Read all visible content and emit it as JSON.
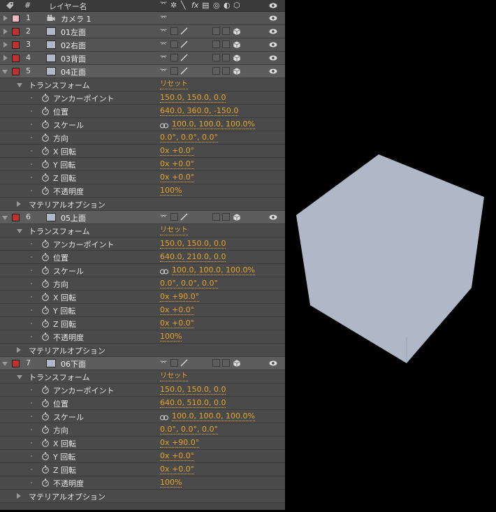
{
  "header": {
    "name_col": "レイヤー名",
    "num_col": "#",
    "fx": "fx"
  },
  "colors": {
    "panel": "#464646",
    "value": "#e8a52a",
    "cube": "#b0b7c6",
    "label_red": "#c0312f",
    "label_pink": "#f0b8c0"
  },
  "layers": [
    {
      "num": "1",
      "name": "カメラ 1",
      "label_color": "#f0b8c0",
      "type": "camera",
      "expanded": false
    },
    {
      "num": "2",
      "name": "01左面",
      "label_color": "#c0312f",
      "type": "solid",
      "expanded": false
    },
    {
      "num": "3",
      "name": "02右面",
      "label_color": "#c0312f",
      "type": "solid",
      "expanded": false
    },
    {
      "num": "4",
      "name": "03背面",
      "label_color": "#c0312f",
      "type": "solid",
      "expanded": false
    },
    {
      "num": "5",
      "name": "04正面",
      "label_color": "#c0312f",
      "type": "solid",
      "expanded": true,
      "transform": {
        "anchor": "150.0, 150.0, 0.0",
        "position": "640.0, 360.0, -150.0",
        "scale": "100.0, 100.0, 100.0%",
        "orientation": "0.0°, 0.0°, 0.0°",
        "x_rot": "0x +0.0°",
        "y_rot": "0x +0.0°",
        "z_rot": "0x +0.0°",
        "opacity": "100%"
      }
    },
    {
      "num": "6",
      "name": "05上面",
      "label_color": "#c0312f",
      "type": "solid",
      "expanded": true,
      "transform": {
        "anchor": "150.0, 150.0, 0.0",
        "position": "640.0, 210.0, 0.0",
        "scale": "100.0, 100.0, 100.0%",
        "orientation": "0.0°, 0.0°, 0.0°",
        "x_rot": "0x +90.0°",
        "y_rot": "0x +0.0°",
        "z_rot": "0x +0.0°",
        "opacity": "100%"
      }
    },
    {
      "num": "7",
      "name": "06下面",
      "label_color": "#c0312f",
      "type": "solid",
      "expanded": true,
      "transform": {
        "anchor": "150.0, 150.0, 0.0",
        "position": "640.0, 510.0, 0.0",
        "scale": "100.0, 100.0, 100.0%",
        "orientation": "0.0°, 0.0°, 0.0°",
        "x_rot": "0x +90.0°",
        "y_rot": "0x +0.0°",
        "z_rot": "0x +0.0°",
        "opacity": "100%"
      }
    }
  ],
  "labels": {
    "transform": "トランスフォーム",
    "reset": "リセット",
    "anchor": "アンカーポイント",
    "position": "位置",
    "scale": "スケール",
    "orientation": "方向",
    "x_rot": "X 回転",
    "y_rot": "Y 回転",
    "z_rot": "Z 回転",
    "opacity": "不透明度",
    "material": "マテリアルオプション"
  }
}
